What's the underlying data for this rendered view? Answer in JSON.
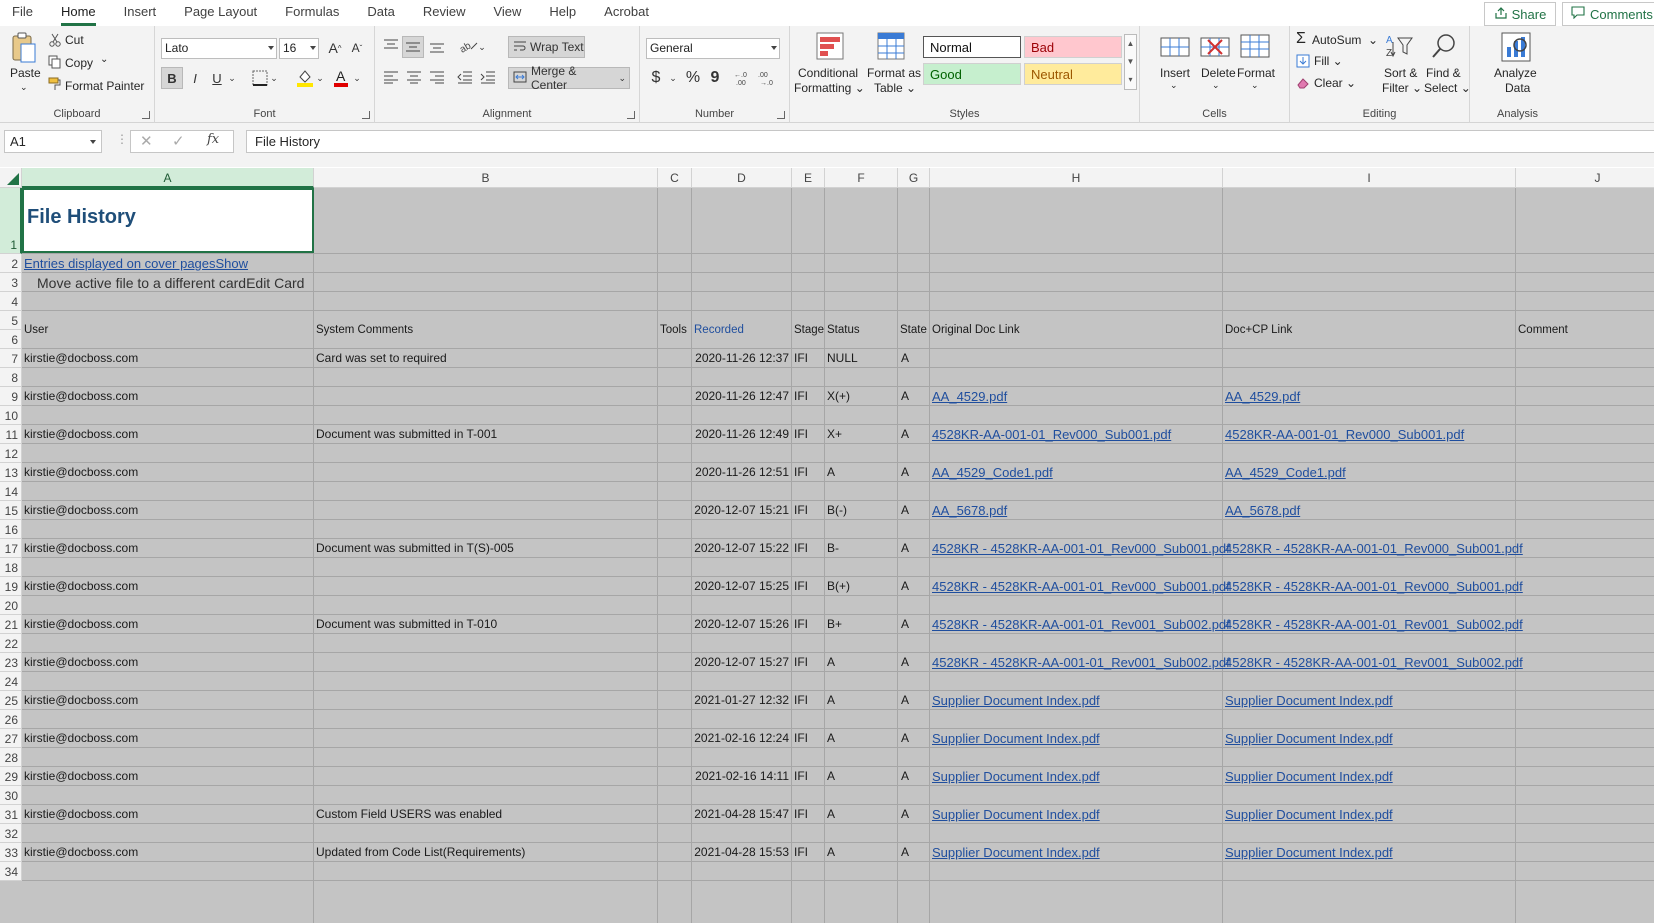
{
  "menu": {
    "tabs": [
      "File",
      "Home",
      "Insert",
      "Page Layout",
      "Formulas",
      "Data",
      "Review",
      "View",
      "Help",
      "Acrobat"
    ],
    "active": "Home",
    "share_label": "Share",
    "comments_label": "Comments"
  },
  "ribbon": {
    "clipboard": {
      "label": "Clipboard",
      "paste": "Paste",
      "cut": "Cut",
      "copy": "Copy",
      "format_painter": "Format Painter"
    },
    "font": {
      "label": "Font",
      "family": "Lato",
      "size": "16"
    },
    "alignment": {
      "label": "Alignment",
      "wrap_text": "Wrap Text",
      "merge_center": "Merge & Center"
    },
    "number": {
      "label": "Number",
      "format": "General",
      "currency": "$",
      "percent": "%",
      "comma": "9"
    },
    "styles": {
      "label": "Styles",
      "conditional_formatting_1": "Conditional",
      "conditional_formatting_2": "Formatting",
      "format_as_table_1": "Format as",
      "format_as_table_2": "Table",
      "normal": "Normal",
      "bad": "Bad",
      "good": "Good",
      "neutral": "Neutral"
    },
    "cells": {
      "label": "Cells",
      "insert": "Insert",
      "delete": "Delete",
      "format": "Format"
    },
    "editing": {
      "label": "Editing",
      "autosum": "AutoSum",
      "fill": "Fill",
      "clear": "Clear",
      "sort_filter_1": "Sort &",
      "sort_filter_2": "Filter",
      "find_select_1": "Find &",
      "find_select_2": "Select"
    },
    "analysis": {
      "label": "Analysis",
      "analyze_1": "Analyze",
      "analyze_2": "Data"
    }
  },
  "formula_bar": {
    "name_box": "A1",
    "fx": "fx",
    "content": "File History"
  },
  "colors": {
    "accent": "#217346",
    "link": "#1f4e9e",
    "grid_bg": "#c4c4c4",
    "title": "#1f4e79"
  },
  "sheet": {
    "columns": [
      "A",
      "B",
      "C",
      "D",
      "E",
      "F",
      "G",
      "H",
      "I",
      "J"
    ],
    "row_numbers": [
      "1",
      "2",
      "3",
      "4",
      "5",
      "6",
      "7",
      "8",
      "9",
      "10",
      "11",
      "12",
      "13",
      "14",
      "15",
      "16",
      "17",
      "18",
      "19",
      "20",
      "21",
      "22",
      "23",
      "24",
      "25",
      "26",
      "27",
      "28",
      "29",
      "30",
      "31",
      "32",
      "33",
      "34"
    ],
    "title": "File History",
    "row2_link": "Entries displayed on cover pagesShow",
    "row3_text": "Move active file to a different cardEdit Card",
    "headers": {
      "user": "User",
      "system_comments": "System Comments",
      "tools": "Tools",
      "recorded": "Recorded",
      "stage": "Stage",
      "status": "Status",
      "state": "State",
      "original_doc_link": "Original Doc Link",
      "doc_cp_link": "Doc+CP Link",
      "comments": "Comment"
    },
    "rows": [
      {
        "user": "kirstie@docboss.com",
        "comment": "Card was set to required",
        "recorded": "2020-11-26 12:37",
        "stage": "IFI",
        "status": "NULL",
        "state": "A",
        "orig": "",
        "doccp": ""
      },
      {
        "user": "kirstie@docboss.com",
        "comment": "",
        "recorded": "2020-11-26 12:47",
        "stage": "IFI",
        "status": "X(+)",
        "state": "A",
        "orig": "AA_4529.pdf",
        "doccp": "AA_4529.pdf"
      },
      {
        "user": "kirstie@docboss.com",
        "comment": "Document was submitted in T-001",
        "recorded": "2020-11-26 12:49",
        "stage": "IFI",
        "status": "X+",
        "state": "A",
        "orig": "4528KR-AA-001-01_Rev000_Sub001.pdf",
        "doccp": "4528KR-AA-001-01_Rev000_Sub001.pdf"
      },
      {
        "user": "kirstie@docboss.com",
        "comment": "",
        "recorded": "2020-11-26 12:51",
        "stage": "IFI",
        "status": "A",
        "state": "A",
        "orig": "AA_4529_Code1.pdf",
        "doccp": "AA_4529_Code1.pdf"
      },
      {
        "user": "kirstie@docboss.com",
        "comment": "",
        "recorded": "2020-12-07 15:21",
        "stage": "IFI",
        "status": "B(-)",
        "state": "A",
        "orig": "AA_5678.pdf",
        "doccp": "AA_5678.pdf"
      },
      {
        "user": "kirstie@docboss.com",
        "comment": "Document was submitted in T(S)-005",
        "recorded": "2020-12-07 15:22",
        "stage": "IFI",
        "status": "B-",
        "state": "A",
        "orig": "4528KR - 4528KR-AA-001-01_Rev000_Sub001.pdf",
        "doccp": "4528KR - 4528KR-AA-001-01_Rev000_Sub001.pdf"
      },
      {
        "user": "kirstie@docboss.com",
        "comment": "",
        "recorded": "2020-12-07 15:25",
        "stage": "IFI",
        "status": "B(+)",
        "state": "A",
        "orig": "4528KR - 4528KR-AA-001-01_Rev000_Sub001.pdf",
        "doccp": "4528KR - 4528KR-AA-001-01_Rev000_Sub001.pdf"
      },
      {
        "user": "kirstie@docboss.com",
        "comment": "Document was submitted in T-010",
        "recorded": "2020-12-07 15:26",
        "stage": "IFI",
        "status": "B+",
        "state": "A",
        "orig": "4528KR - 4528KR-AA-001-01_Rev001_Sub002.pdf",
        "doccp": "4528KR - 4528KR-AA-001-01_Rev001_Sub002.pdf"
      },
      {
        "user": "kirstie@docboss.com",
        "comment": "",
        "recorded": "2020-12-07 15:27",
        "stage": "IFI",
        "status": "A",
        "state": "A",
        "orig": "4528KR - 4528KR-AA-001-01_Rev001_Sub002.pdf",
        "doccp": "4528KR - 4528KR-AA-001-01_Rev001_Sub002.pdf"
      },
      {
        "user": "kirstie@docboss.com",
        "comment": "",
        "recorded": "2021-01-27 12:32",
        "stage": "IFI",
        "status": "A",
        "state": "A",
        "orig": "Supplier Document Index.pdf",
        "doccp": "Supplier Document Index.pdf"
      },
      {
        "user": "kirstie@docboss.com",
        "comment": "",
        "recorded": "2021-02-16 12:24",
        "stage": "IFI",
        "status": "A",
        "state": "A",
        "orig": "Supplier Document Index.pdf",
        "doccp": "Supplier Document Index.pdf"
      },
      {
        "user": "kirstie@docboss.com",
        "comment": "",
        "recorded": "2021-02-16 14:11",
        "stage": "IFI",
        "status": "A",
        "state": "A",
        "orig": "Supplier Document Index.pdf",
        "doccp": "Supplier Document Index.pdf"
      },
      {
        "user": "kirstie@docboss.com",
        "comment": "Custom Field USERS was enabled",
        "recorded": "2021-04-28 15:47",
        "stage": "IFI",
        "status": "A",
        "state": "A",
        "orig": "Supplier Document Index.pdf",
        "doccp": "Supplier Document Index.pdf"
      },
      {
        "user": "kirstie@docboss.com",
        "comment": "Updated from Code List(Requirements)",
        "recorded": "2021-04-28 15:53",
        "stage": "IFI",
        "status": "A",
        "state": "A",
        "orig": "Supplier Document Index.pdf",
        "doccp": "Supplier Document Index.pdf"
      }
    ]
  }
}
